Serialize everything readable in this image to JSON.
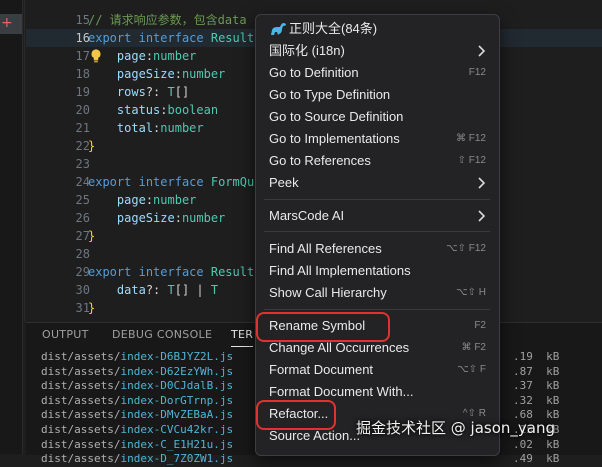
{
  "activity_bar": {
    "plus_glyph": "+"
  },
  "editor": {
    "lines": [
      {
        "num": "15",
        "tokens": [
          [
            "comment",
            "// 请求响应参数，包含data"
          ]
        ]
      },
      {
        "num": "16",
        "current": true,
        "tokens": [
          [
            "keyword",
            "export"
          ],
          [
            "plain",
            " "
          ],
          [
            "keyword",
            "interface"
          ],
          [
            "plain",
            " "
          ],
          [
            "type",
            "Result"
          ]
        ]
      },
      {
        "num": "17",
        "tokens": [
          [
            "plain",
            "    "
          ],
          [
            "prop",
            "page"
          ],
          [
            "punct",
            ":"
          ],
          [
            "type",
            "number"
          ]
        ]
      },
      {
        "num": "18",
        "tokens": [
          [
            "plain",
            "    "
          ],
          [
            "prop",
            "pageSize"
          ],
          [
            "punct",
            ":"
          ],
          [
            "type",
            "number"
          ]
        ]
      },
      {
        "num": "19",
        "tokens": [
          [
            "plain",
            "    "
          ],
          [
            "prop",
            "rows"
          ],
          [
            "punct",
            "?: "
          ],
          [
            "type",
            "T"
          ],
          [
            "punct",
            "[]"
          ]
        ]
      },
      {
        "num": "20",
        "tokens": [
          [
            "plain",
            "    "
          ],
          [
            "prop",
            "status"
          ],
          [
            "punct",
            ":"
          ],
          [
            "type",
            "boolean"
          ]
        ]
      },
      {
        "num": "21",
        "tokens": [
          [
            "plain",
            "    "
          ],
          [
            "prop",
            "total"
          ],
          [
            "punct",
            ":"
          ],
          [
            "type",
            "number"
          ]
        ]
      },
      {
        "num": "22",
        "tokens": [
          [
            "brace",
            "}"
          ]
        ]
      },
      {
        "num": "23",
        "tokens": []
      },
      {
        "num": "24",
        "tokens": [
          [
            "keyword",
            "export"
          ],
          [
            "plain",
            " "
          ],
          [
            "keyword",
            "interface"
          ],
          [
            "plain",
            " "
          ],
          [
            "type",
            "FormQu"
          ]
        ]
      },
      {
        "num": "25",
        "tokens": [
          [
            "plain",
            "    "
          ],
          [
            "prop",
            "page"
          ],
          [
            "punct",
            ":"
          ],
          [
            "type",
            "number"
          ]
        ]
      },
      {
        "num": "26",
        "tokens": [
          [
            "plain",
            "    "
          ],
          [
            "prop",
            "pageSize"
          ],
          [
            "punct",
            ":"
          ],
          [
            "type",
            "number"
          ]
        ]
      },
      {
        "num": "27",
        "tokens": [
          [
            "brace",
            "}"
          ]
        ]
      },
      {
        "num": "28",
        "tokens": []
      },
      {
        "num": "29",
        "tokens": [
          [
            "keyword",
            "export"
          ],
          [
            "plain",
            " "
          ],
          [
            "keyword",
            "interface"
          ],
          [
            "plain",
            " "
          ],
          [
            "type",
            "Result"
          ]
        ]
      },
      {
        "num": "30",
        "tokens": [
          [
            "plain",
            "    "
          ],
          [
            "prop",
            "data"
          ],
          [
            "punct",
            "?: "
          ],
          [
            "type",
            "T"
          ],
          [
            "punct",
            "[] | "
          ],
          [
            "type",
            "T"
          ]
        ]
      },
      {
        "num": "31",
        "tokens": [
          [
            "brace",
            "}"
          ]
        ]
      }
    ]
  },
  "panel": {
    "tabs": [
      {
        "label": "OUTPUT"
      },
      {
        "label": "DEBUG CONSOLE"
      },
      {
        "label": "TER",
        "active": true
      }
    ],
    "terminal": [
      {
        "dir": "dist/assets/",
        "file": "index-D6BJYZ2L.js",
        "size": ".19  kB"
      },
      {
        "dir": "dist/assets/",
        "file": "index-D62EzYWh.js",
        "size": ".87  kB"
      },
      {
        "dir": "dist/assets/",
        "file": "index-D0CJdalB.js",
        "size": ".37  kB"
      },
      {
        "dir": "dist/assets/",
        "file": "index-DorGTrnp.js",
        "size": ".32  kB"
      },
      {
        "dir": "dist/assets/",
        "file": "index-DMvZEBaA.js",
        "size": ".68  kB"
      },
      {
        "dir": "dist/assets/",
        "file": "index-CVCu42kr.js",
        "size": ".15  kB"
      },
      {
        "dir": "dist/assets/",
        "file": "index-C_E1H21u.js",
        "size": ".02  kB"
      },
      {
        "dir": "dist/assets/",
        "file": "index-D_7Z0ZW1.js",
        "size": ".49  kB"
      }
    ]
  },
  "context_menu": {
    "items": [
      {
        "label": "正则大全(84条)",
        "icon": "dinosaur-icon"
      },
      {
        "label": "国际化 (i18n)",
        "submenu": true
      },
      {
        "label": "Go to Definition",
        "shortcut": "F12"
      },
      {
        "label": "Go to Type Definition"
      },
      {
        "label": "Go to Source Definition"
      },
      {
        "label": "Go to Implementations",
        "shortcut": "⌘ F12"
      },
      {
        "label": "Go to References",
        "shortcut": "⇧ F12"
      },
      {
        "label": "Peek",
        "submenu": true
      },
      {
        "label": "MarsCode AI",
        "submenu": true
      },
      {
        "label": "Find All References",
        "shortcut": "⌥⇧ F12"
      },
      {
        "label": "Find All Implementations"
      },
      {
        "label": "Show Call Hierarchy",
        "shortcut": "⌥⇧ H"
      },
      {
        "label": "Rename Symbol",
        "shortcut": "F2"
      },
      {
        "label": "Change All Occurrences",
        "shortcut": "⌘ F2"
      },
      {
        "label": "Format Document",
        "shortcut": "⌥⇧ F"
      },
      {
        "label": "Format Document With..."
      },
      {
        "label": "Refactor...",
        "shortcut": "^⇧ R"
      },
      {
        "label": "Source Action..."
      }
    ],
    "highlight_color": "#e0322f"
  },
  "watermark": {
    "text": "掘金技术社区 @ jason_yang"
  }
}
